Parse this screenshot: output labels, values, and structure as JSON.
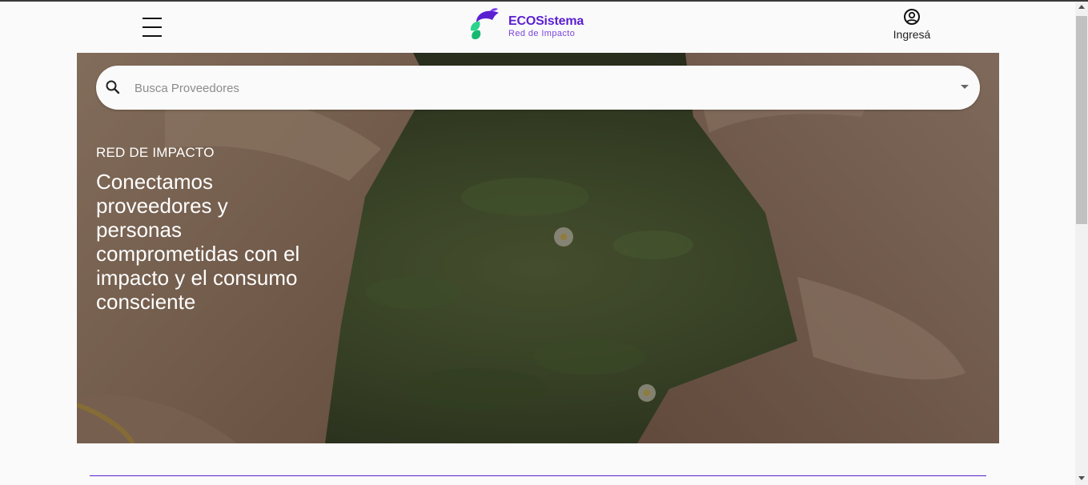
{
  "header": {
    "menu_icon": "hamburger-menu-icon",
    "logo": {
      "title": "ECOSistema",
      "subtitle": "Red de Impacto",
      "icon": "ecosistema-leaves-logo"
    },
    "login": {
      "label": "Ingresá",
      "icon": "account-circle-icon"
    }
  },
  "hero": {
    "background": "hands-forming-circle-over-grass-photo",
    "search": {
      "placeholder": "Busca Proveedores",
      "value": "",
      "icon": "search-icon",
      "dropdown_icon": "caret-down-icon"
    },
    "eyebrow": "RED DE IMPACTO",
    "headline": "Conectamos proveedores y personas comprometidas con el impacto y el consumo consciente"
  },
  "colors": {
    "brand_purple": "#5a1fd1",
    "brand_green": "#2bd48a",
    "hero_text": "#ffffff"
  }
}
